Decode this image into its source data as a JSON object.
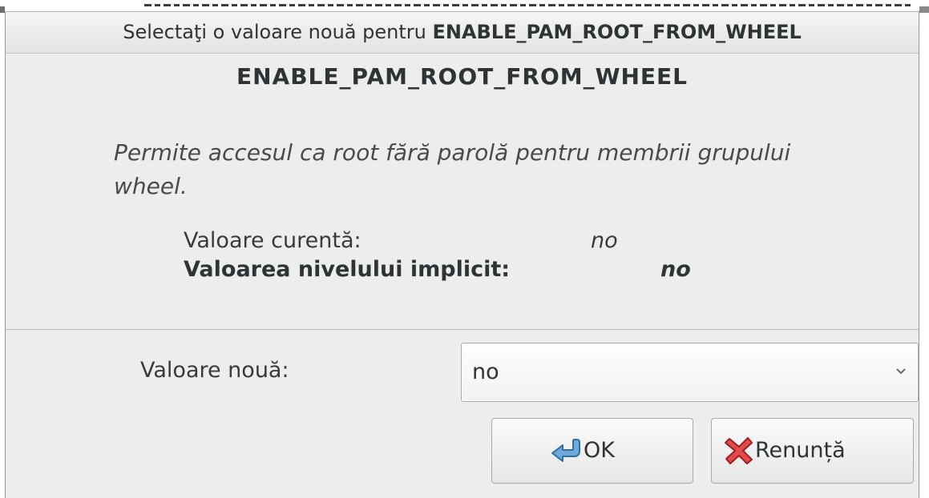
{
  "window": {
    "title_prefix": "Selectaţi o valoare nouă pentru ",
    "title_var": "ENABLE_PAM_ROOT_FROM_WHEEL"
  },
  "heading": "ENABLE_PAM_ROOT_FROM_WHEEL",
  "description": "Permite accesul ca root fără parolă pentru membrii grupului wheel.",
  "current": {
    "label": "Valoare curentă:",
    "value": "no"
  },
  "default": {
    "label": "Valoarea nivelului implicit:",
    "value": "no"
  },
  "new_value": {
    "label": "Valoare nouă:",
    "selected": "no"
  },
  "buttons": {
    "ok": "OK",
    "cancel": "Renunță"
  },
  "icons": {
    "ok": "return-arrow-icon",
    "cancel": "red-x-icon",
    "dropdown": "chevron-down-icon"
  },
  "colors": {
    "ok_icon": "#5b9bd5",
    "cancel_icon": "#d93c3c"
  }
}
